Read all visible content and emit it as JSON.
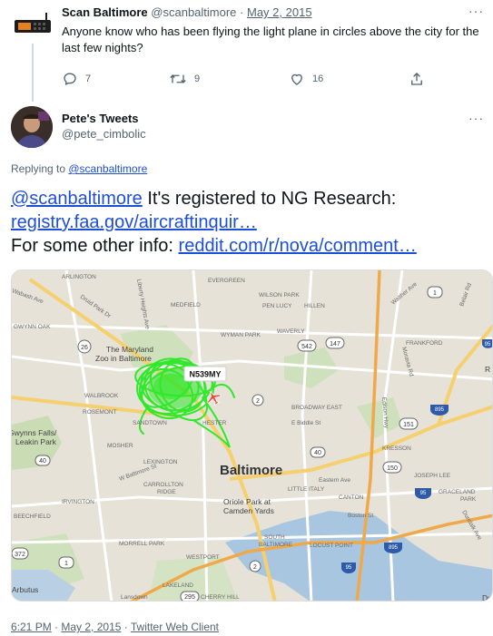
{
  "parent_tweet": {
    "name": "Scan Baltimore",
    "handle": "@scanbaltimore",
    "separator": "·",
    "date": "May 2, 2015",
    "more": "···",
    "text": "Anyone know who has been flying the light plane in circles above the city for the last few nights?",
    "reply_count": "7",
    "retweet_count": "9",
    "like_count": "16",
    "icons": [
      "reply-icon",
      "retweet-icon",
      "like-icon",
      "share-icon"
    ]
  },
  "reply_tweet": {
    "name": "Pete's Tweets",
    "handle": "@pete_cimbolic",
    "more": "···",
    "replying_prefix": "Replying to ",
    "replying_to": "@scanbaltimore",
    "text_mention": "@scanbaltimore",
    "text_line1_rest": " It's registered to NG Research:",
    "link1": "registry.faa.gov/aircraftinquir…",
    "text_line3_prefix": "For some other info: ",
    "link2": "reddit.com/r/nova/comment…"
  },
  "map": {
    "aircraft_label": "N539MY",
    "places": {
      "arlington": "ARLINGTON",
      "evergreen": "EVERGREEN",
      "wilson_park": "WILSON PARK",
      "pen_lucy": "PEN LUCY",
      "hillen": "HILLEN",
      "medfield": "MEDFIELD",
      "gwynn_oak": "GWYNN OAK",
      "zoo_l1": "The Maryland",
      "zoo_l2": "Zoo in Baltimore",
      "wyman_park": "WYMAN PARK",
      "waverly": "WAVERLY",
      "frankford": "FRANKFORD",
      "walbrook": "WALBROOK",
      "rosemont": "ROSEMONT",
      "sandtown": "SANDTOWN",
      "hester": "HESTER",
      "broadway_east": "BROADWAY EAST",
      "e_biddle": "E Biddle St",
      "gwynns_l1": "Gwynns Falls/",
      "gwynns_l2": "Leakin Park",
      "mosher": "MOSHER",
      "kresson": "KRESSON",
      "lexington": "LEXINGTON",
      "baltimore": "Baltimore",
      "w_baltimore_st": "W Baltimore St",
      "carrollton_l1": "CARROLLTON",
      "carrollton_l2": "RIDGE",
      "little_italy": "LITTLE ITALY",
      "eastern_ave": "Eastern Ave",
      "canton": "CANTON",
      "joseph_lee": "JOSEPH LEE",
      "graceland_l1": "GRACELAND",
      "graceland_l2": "PARK",
      "irvington": "IRVINGTON",
      "beechfield": "BEECHFIELD",
      "oriole_l1": "Oriole Park at",
      "oriole_l2": "Camden Yards",
      "boston_st": "Boston St",
      "morrell_park": "MORRELL PARK",
      "south_baltimore_l1": "SOUTH",
      "south_baltimore_l2": "BALTIMORE",
      "locust_point": "LOCUST POINT",
      "westport": "WESTPORT",
      "arbutus": "Arbutus",
      "lakeland": "LAKELAND",
      "lansdowne": "Lansdown",
      "cherry_hill": "CHERRY HILL",
      "r": "R",
      "du": "Du",
      "dundalk_ave": "Dundalk Ave",
      "edison_hwy": "Edison Hwy",
      "moravia_rd": "Moravia Rd",
      "walther_ave": "Walther Ave",
      "belair_rd": "Belair Rd",
      "liberty_hts": "Liberty Heights Ave",
      "wabash_ave": "Wabash Ave",
      "druid_park": "Druid Park Dr"
    },
    "shields": {
      "s26": "26",
      "s542": "542",
      "s147": "147",
      "s40a": "40",
      "s40b": "40",
      "s2a": "2",
      "s1a": "1",
      "s150": "150",
      "s151": "151",
      "s895a": "895",
      "s95a": "95",
      "s95b": "95",
      "s372": "372",
      "s1b": "1",
      "s2b": "2",
      "s895b": "895",
      "s295": "295",
      "s95c": "95"
    }
  },
  "footer": {
    "time": "6:21 PM",
    "separator": " · ",
    "date": "May 2, 2015",
    "client": "Twitter Web Client"
  }
}
